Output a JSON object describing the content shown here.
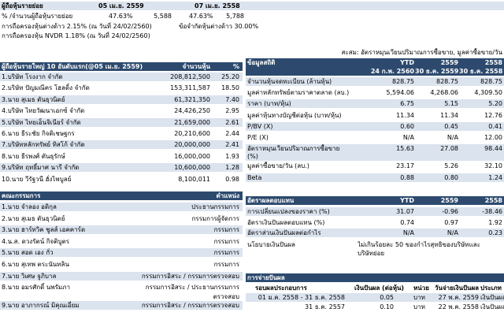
{
  "top": {
    "label": "ผู้ถือหุ้นรายย่อย",
    "date1": "05 เม.ย. 2559",
    "date2": "07 เม.ย. 2558",
    "pct_label": "% /จำนวนผู้ถือหุ้นรายย่อย",
    "pct1": "47.63%",
    "cnt1": "5,588",
    "pct2": "47.63%",
    "cnt2": "5,788",
    "foreign": "การถือครองหุ้นต่างด้าว 2.15% (ณ วันที่ 24/02/2560)",
    "foreign_limit": "ข้อจำกัดหุ้นต่างด้าว 30.00%",
    "nvdr": "การถือครองหุ้น NVDR  1.18% (ณ วันที่ 24/02/2560)"
  },
  "shareholders": {
    "title": "ผู้ถือหุ้นรายใหญ่ 10 อันดับแรก(@05 เม.ย. 2559)",
    "col_shares": "จำนวนหุ้น",
    "col_pct": "%",
    "rows": [
      {
        "name": "1.บริษัท โรงงาก จำกัด",
        "shares": "208,812,500",
        "pct": "25.20"
      },
      {
        "name": "2.บริษัท ปัญมณีคร โฮลดิ้ง จำกัด",
        "shares": "153,311,587",
        "pct": "18.50"
      },
      {
        "name": "3.นาย สุเมธ ตันธุวนิตย์",
        "shares": "61,321,350",
        "pct": "7.40"
      },
      {
        "name": "4.บริษัท ไทยวัฒนาเอกซ์ จำกัด",
        "shares": "24,426,250",
        "pct": "2.95"
      },
      {
        "name": "5.บริษัท ไทยเอ็นจิเนียร์ จำกัด",
        "shares": "21,659,000",
        "pct": "2.61"
      },
      {
        "name": "6.นาย ธีระชัย กิจติเชษฐกร",
        "shares": "20,210,600",
        "pct": "2.44"
      },
      {
        "name": "7.บริษัทหลักทรัพย์ ทิสโก้ จำกัด",
        "shares": "20,000,000",
        "pct": "2.41"
      },
      {
        "name": "8.นาย ธีรพงศ์ ตันธุรักษ์",
        "shares": "16,000,000",
        "pct": "1.93"
      },
      {
        "name": "9.บริษัท ฤทธิ์มาศ นารี จำกัด",
        "shares": "10,600,000",
        "pct": "1.28"
      },
      {
        "name": "10.นาย วีรัฐวนี ฮั่งไพบูลย์",
        "shares": "8,100,011",
        "pct": "0.98"
      }
    ]
  },
  "board": {
    "title": "คณะกรรมการ",
    "col_pos": "ตำแหน่ง",
    "rows": [
      {
        "name": "1.นาย จำลอง อดิกุล",
        "pos": "ประธานกรรมการ",
        "pos2": ""
      },
      {
        "name": "2.นาย สุเมธ ตันธุวนิตย์",
        "pos": "กรรมการผู้จัดการ",
        "pos2": ""
      },
      {
        "name": "3.นาย ฮาร์ทวิค ชูลส์ เอคคาร์ด",
        "pos": "กรรมการ",
        "pos2": ""
      },
      {
        "name": "4.น.ส. ดวงรัตน์ กิจติบูตร",
        "pos": "กรรมการ",
        "pos2": ""
      },
      {
        "name": "5.นาย สอด เอง กั่ว",
        "pos": "กรรมการ",
        "pos2": ""
      },
      {
        "name": "6.นาย สุเทพ ตระนันทลิน",
        "pos": "กรรมการ",
        "pos2": ""
      },
      {
        "name": "7.นาย วิเศษ จูภิบาล",
        "pos": "กรรมการอิสระ / กรรมการตรวจสอบ",
        "pos2": ""
      },
      {
        "name": "8.นาย อมรศักดิ์ นพรัมภา",
        "pos": "กรรมการอิสระ / ประธานกรรมการ",
        "pos2": "ตรวจสอบ"
      },
      {
        "name": "9.นาย อาภากรณ์ มิคุณเอี่ยม",
        "pos": "กรรมการอิสระ / กรรมการตรวจสอบ",
        "pos2": ""
      }
    ]
  },
  "stats": {
    "note": "สะสม: อัตราหมุนเวียนปริมาณการซื้อขาย, มูลค่าซื้อขาย/วัน",
    "title": "ข้อมูลสถิติ",
    "cols": [
      "YTD",
      "2559",
      "2558"
    ],
    "dates": [
      "24 ก.พ. 2560",
      "30 ธ.ค. 2559",
      "30 ธ.ค. 2558"
    ],
    "rows": [
      {
        "label": "จำนวนหุ้นจดทะเบียน (ล้านหุ้น)",
        "v": [
          "828.75",
          "828.75",
          "828.75"
        ],
        "l2": ""
      },
      {
        "label": "มูลค่าหลักทรัพย์ตามราคาตลาด (ลบ.)",
        "v": [
          "5,594.06",
          "4,268.06",
          "4,309.50"
        ],
        "l2": ""
      },
      {
        "label": "ราคา (บาท/หุ้น)",
        "v": [
          "6.75",
          "5.15",
          "5.20"
        ],
        "l2": ""
      },
      {
        "label": "มูลค่าหุ้นทางบัญชีต่อหุ้น (บาท/หุ้น)",
        "v": [
          "11.34",
          "11.34",
          "12.76"
        ],
        "l2": ""
      },
      {
        "label": "P/BV (X)",
        "v": [
          "0.60",
          "0.45",
          "0.41"
        ],
        "l2": ""
      },
      {
        "label": "P/E (X)",
        "v": [
          "N/A",
          "N/A",
          "12.00"
        ],
        "l2": ""
      },
      {
        "label": "อัตราหมุนเวียนปริมาณการซื้อขาย",
        "v": [
          "15.63",
          "27.08",
          "98.44"
        ],
        "l2": "(%)"
      },
      {
        "label": "มูลค่าซื้อขาย/วัน (ลบ.)",
        "v": [
          "23.17",
          "5.26",
          "32.10"
        ],
        "l2": ""
      },
      {
        "label": "Beta",
        "v": [
          "0.88",
          "0.80",
          "1.24"
        ],
        "l2": ""
      }
    ]
  },
  "returns": {
    "title": "อัตราผลตอบแทน",
    "cols": [
      "YTD",
      "2559",
      "2558"
    ],
    "rows": [
      {
        "label": "การเปลี่ยนแปลงของราคา (%)",
        "v": [
          "31.07",
          "-0.96",
          "-38.46"
        ]
      },
      {
        "label": "อัตราเงินปันผลตอบแทน (%)",
        "v": [
          "0.74",
          "0.97",
          "1.92"
        ]
      },
      {
        "label": "อัตราส่วนเงินปันผลต่อกำไร",
        "v": [
          "N/A",
          "N/A",
          "0.23"
        ]
      }
    ],
    "policy_label": "นโยบายเงินปันผล",
    "policy_text1": "ไม่เกินร้อยละ 50 ของกำไรสุทธิของบริษัทและ",
    "policy_text2": "บริษัทย่อย"
  },
  "dividend": {
    "title": "การจ่ายปันผล",
    "col_period": "รอบผลประกอบการ",
    "col_amount": "เงินปันผล (ต่อหุ้น)",
    "col_unit": "หน่วย",
    "col_paydate": "วันจ่ายเงินปันผล",
    "col_type": "ประเภท",
    "rows": [
      {
        "period": "01 ม.ค. 2558 - 31 ธ.ค. 2558",
        "amount": "0.05",
        "unit": "บาท",
        "paydate": "27 พ.ค. 2559",
        "type": "เงินปันผล"
      },
      {
        "period": "31 ธ.ค. 2557",
        "amount": "0.10",
        "unit": "บาท",
        "paydate": "22 พ.ค. 2558",
        "type": "เงินปันผล"
      }
    ]
  }
}
